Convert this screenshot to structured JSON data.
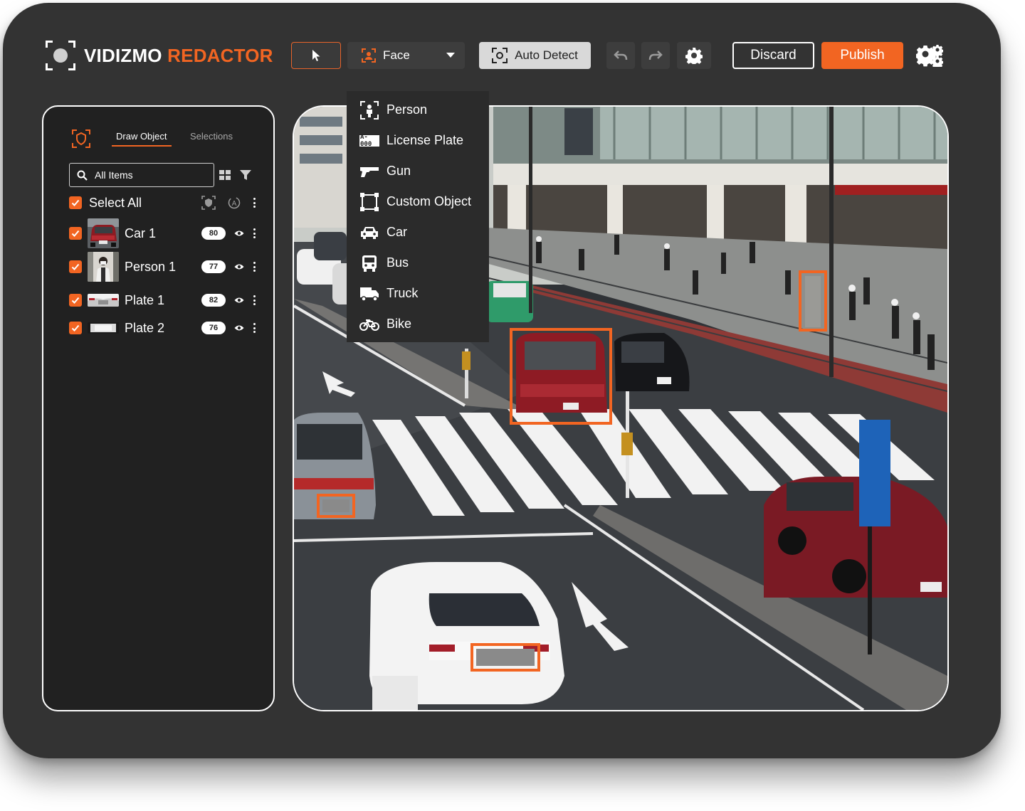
{
  "app": {
    "brand_primary": "VIDIZMO",
    "brand_accent": "REDACTOR",
    "accent_color": "#f26522"
  },
  "toolbar": {
    "pointer_icon": "cursor-arrow-icon",
    "object_type_selected": "Face",
    "auto_detect_label": "Auto Detect",
    "undo_icon": "undo-icon",
    "redo_icon": "redo-icon",
    "settings_icon": "gear-icon",
    "discard_label": "Discard",
    "publish_label": "Publish",
    "advanced_settings_icon": "gears-icon"
  },
  "dropdown": {
    "items": [
      {
        "label": "Person",
        "icon": "person-frame-icon"
      },
      {
        "label": "License Plate",
        "icon": "license-plate-icon",
        "icon_text": "A-000"
      },
      {
        "label": "Gun",
        "icon": "gun-icon"
      },
      {
        "label": "Custom Object",
        "icon": "custom-object-icon"
      },
      {
        "label": "Car",
        "icon": "car-icon"
      },
      {
        "label": "Bus",
        "icon": "bus-icon"
      },
      {
        "label": "Truck",
        "icon": "truck-icon"
      },
      {
        "label": "Bike",
        "icon": "bike-icon"
      }
    ]
  },
  "sidebar": {
    "tabs": [
      {
        "label": "Draw Object",
        "active": true
      },
      {
        "label": "Selections",
        "active": false
      }
    ],
    "search_value": "All Items",
    "select_all_label": "Select All",
    "items": [
      {
        "label": "Car 1",
        "count": "80",
        "checked": true
      },
      {
        "label": "Person 1",
        "count": "77",
        "checked": true
      },
      {
        "label": "Plate 1",
        "count": "82",
        "checked": true
      },
      {
        "label": "Plate 2",
        "count": "76",
        "checked": true
      }
    ]
  }
}
